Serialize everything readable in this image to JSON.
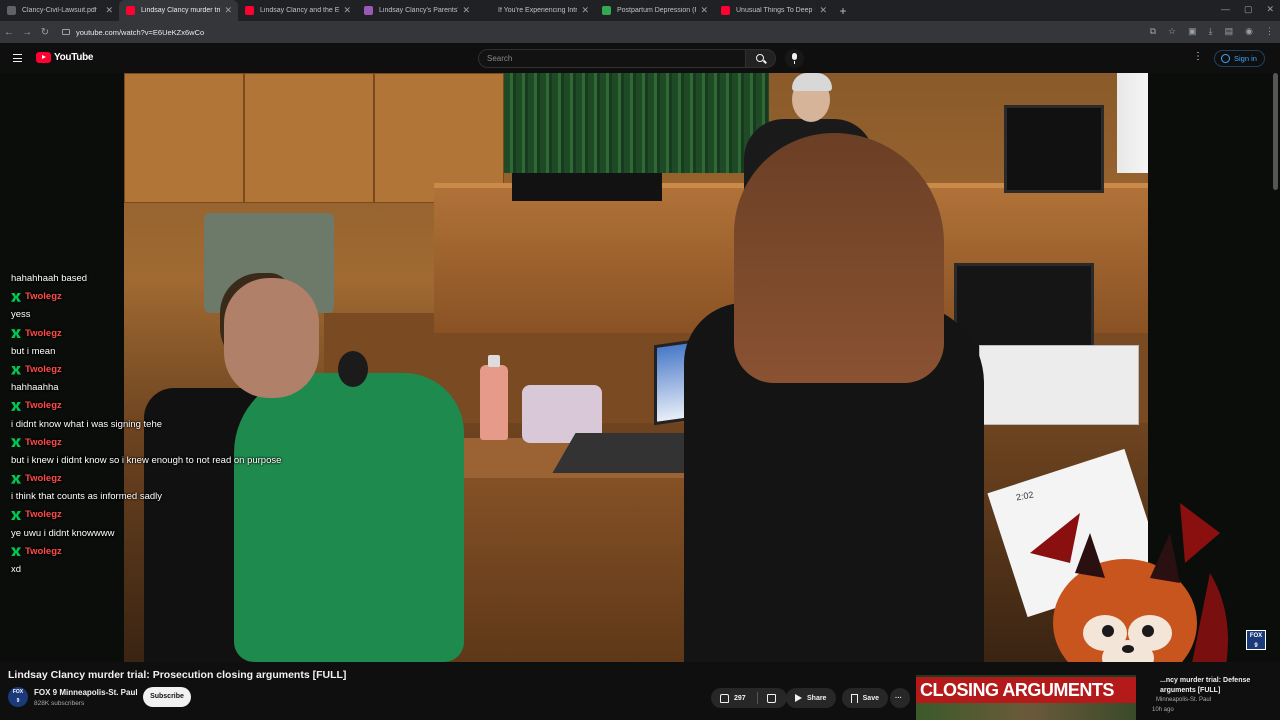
{
  "browser": {
    "tabs": [
      {
        "label": "Clancy-Civil-Lawsuit.pdf",
        "favicon": "pdf",
        "active": false
      },
      {
        "label": "Lindsay Clancy murder tri",
        "favicon": "yt",
        "active": true
      },
      {
        "label": "Lindsay Clancy and the Evidenc",
        "favicon": "yt",
        "active": false
      },
      {
        "label": "Lindsay Clancy's Parents' $1 Mi",
        "favicon": "purple",
        "active": false
      },
      {
        "label": "If You're Experiencing Intrusiv",
        "favicon": "none",
        "active": false
      },
      {
        "label": "Postpartum Depression (PPD) |",
        "favicon": "green",
        "active": false
      },
      {
        "label": "Unusual Things To Deep Fry - Y",
        "favicon": "yt",
        "active": false
      }
    ],
    "url": "youtube.com/watch?v=E6UeKZx6wCo"
  },
  "youtube": {
    "logo_text": "YouTube",
    "search_placeholder": "Search",
    "sign_in": "Sign in"
  },
  "chat": [
    {
      "kind": "msg",
      "text": "hahahhaah based"
    },
    {
      "kind": "user",
      "text": "Twolegz"
    },
    {
      "kind": "msg",
      "text": "yess"
    },
    {
      "kind": "user",
      "text": "Twolegz"
    },
    {
      "kind": "msg",
      "text": "but i mean"
    },
    {
      "kind": "user",
      "text": "Twolegz"
    },
    {
      "kind": "msg",
      "text": "hahhaahha"
    },
    {
      "kind": "user",
      "text": "Twolegz"
    },
    {
      "kind": "msg",
      "text": "i didnt know what i was signing tehe"
    },
    {
      "kind": "user",
      "text": "Twolegz"
    },
    {
      "kind": "msg",
      "text": "but i knew i didnt know so i knew enough to not read on purpose"
    },
    {
      "kind": "user",
      "text": "Twolegz"
    },
    {
      "kind": "msg",
      "text": "i think that counts as informed sadly"
    },
    {
      "kind": "user",
      "text": "Twolegz"
    },
    {
      "kind": "msg",
      "text": "ye uwu i didnt knowwww"
    },
    {
      "kind": "user",
      "text": "Twolegz"
    },
    {
      "kind": "msg",
      "text": "xd"
    }
  ],
  "video": {
    "exhibit_label": "2:02",
    "corner_badge_top": "FOX",
    "corner_badge_bottom": "9"
  },
  "watch": {
    "title": "Lindsay Clancy murder trial: Prosecution closing arguments [FULL]",
    "channel_name": "FOX 9 Minneapolis-St. Paul",
    "subscribers": "828K subscribers",
    "avatar_top": "FOX",
    "avatar_bottom": "9",
    "subscribe_label": "Subscribe",
    "likes": "297",
    "share_label": "Share",
    "save_label": "Save",
    "more_label": "···"
  },
  "related": {
    "thumb_banner": "CLOSING ARGUMENTS",
    "title": "...ncy murder trial: Defense arguments [FULL]",
    "channel": "Minneapolis-St. Paul",
    "age": "10h ago"
  }
}
